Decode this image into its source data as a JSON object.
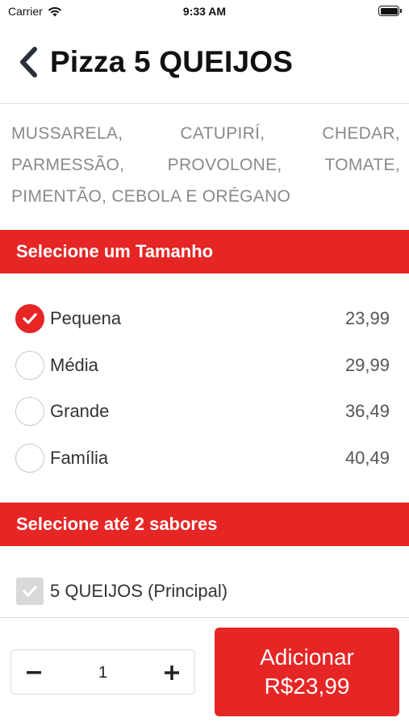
{
  "status_bar": {
    "carrier": "Carrier",
    "time": "9:33 AM"
  },
  "header": {
    "title": "Pizza 5 QUEIJOS"
  },
  "description": "MUSSARELA, CATUPIRÍ, CHEDAR, PARMESSÃO, PROVOLONE, TOMATE, PIMENTÃO, CEBOLA E ORÉGANO",
  "size_section": {
    "title": "Selecione um Tamanho",
    "options": [
      {
        "label": "Pequena",
        "price": "23,99",
        "selected": true
      },
      {
        "label": "Média",
        "price": "29,99",
        "selected": false
      },
      {
        "label": "Grande",
        "price": "36,49",
        "selected": false
      },
      {
        "label": "Família",
        "price": "40,49",
        "selected": false
      }
    ]
  },
  "flavor_section": {
    "title": "Selecione até 2 sabores",
    "items": [
      {
        "label": "5 QUEIJOS (Principal)",
        "checked": true,
        "disabled": true
      }
    ]
  },
  "order": {
    "quantity": "1",
    "add_label": "Adicionar",
    "add_price": "R$23,99"
  },
  "colors": {
    "accent": "#e62525",
    "muted_text": "#8a8a8a"
  }
}
